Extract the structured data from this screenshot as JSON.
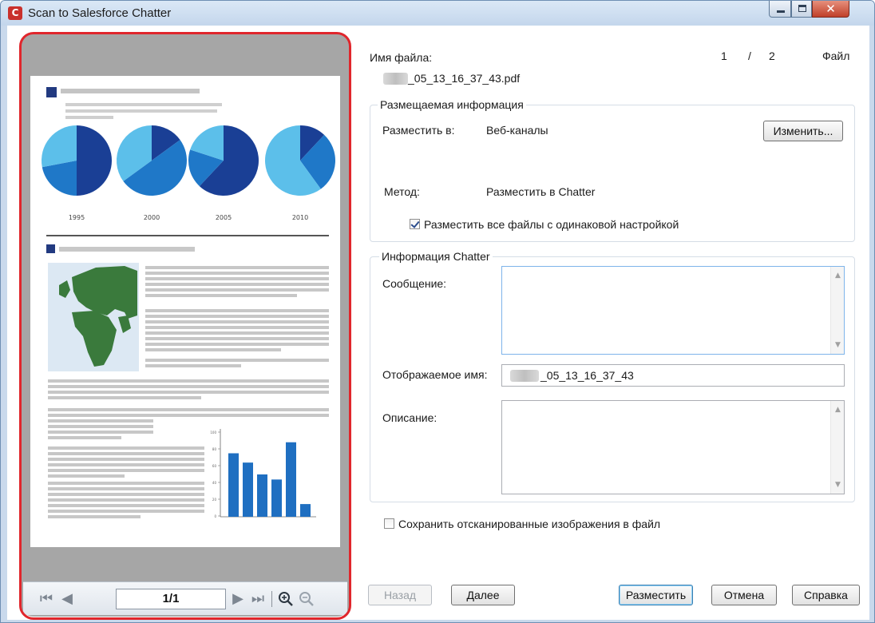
{
  "window": {
    "title": "Scan to Salesforce Chatter",
    "app_icon_glyph": "C",
    "controls": {
      "minimize_icon": "minimize-icon",
      "maximize_icon": "maximize-icon",
      "close_icon": "close-icon",
      "close_glyph": "✕"
    }
  },
  "preview": {
    "pie_years": [
      "1995",
      "2000",
      "2005",
      "2010"
    ],
    "bar_axis_ticks": [
      "100",
      "80",
      "60",
      "40",
      "20",
      "0"
    ],
    "bar_values": [
      75,
      64,
      50,
      44,
      88,
      15
    ],
    "navigation": {
      "first_icon": "first-page-icon",
      "prev_icon": "previous-page-icon",
      "page_value": "1/1",
      "next_icon": "next-page-icon",
      "last_icon": "last-page-icon",
      "zoom_in_icon": "zoom-in-icon",
      "zoom_out_icon": "zoom-out-icon"
    }
  },
  "file": {
    "label": "Имя файла:",
    "index": "1",
    "separator": "/",
    "total": "2",
    "type_label": "Файл",
    "name_suffix": "_05_13_16_37_43.pdf"
  },
  "posting": {
    "group_title": "Размещаемая информация",
    "post_to_label": "Разместить в:",
    "post_to_value": "Веб-каналы",
    "change_button": "Изменить...",
    "method_label": "Метод:",
    "method_value": "Разместить в Chatter",
    "same_settings_checkbox": "Разместить все файлы с одинаковой настройкой",
    "same_settings_checked": true
  },
  "chatter": {
    "group_title": "Информация Chatter",
    "message_label": "Сообщение:",
    "message_value": "",
    "display_name_label": "Отображаемое имя:",
    "display_name_suffix": "_05_13_16_37_43",
    "description_label": "Описание:",
    "description_value": ""
  },
  "save_images_checkbox": "Сохранить отсканированные изображения в файл",
  "save_images_checked": false,
  "buttons": {
    "back": "Назад",
    "next": "Далее",
    "post": "Разместить",
    "cancel": "Отмена",
    "help": "Справка"
  },
  "colors": {
    "highlight_outline": "#e0262c",
    "pie_dark": "#1a3f95",
    "pie_mid": "#1f78c8",
    "pie_light": "#5cbfea",
    "bar": "#1f6fc1",
    "map_land": "#3a7a3c"
  }
}
